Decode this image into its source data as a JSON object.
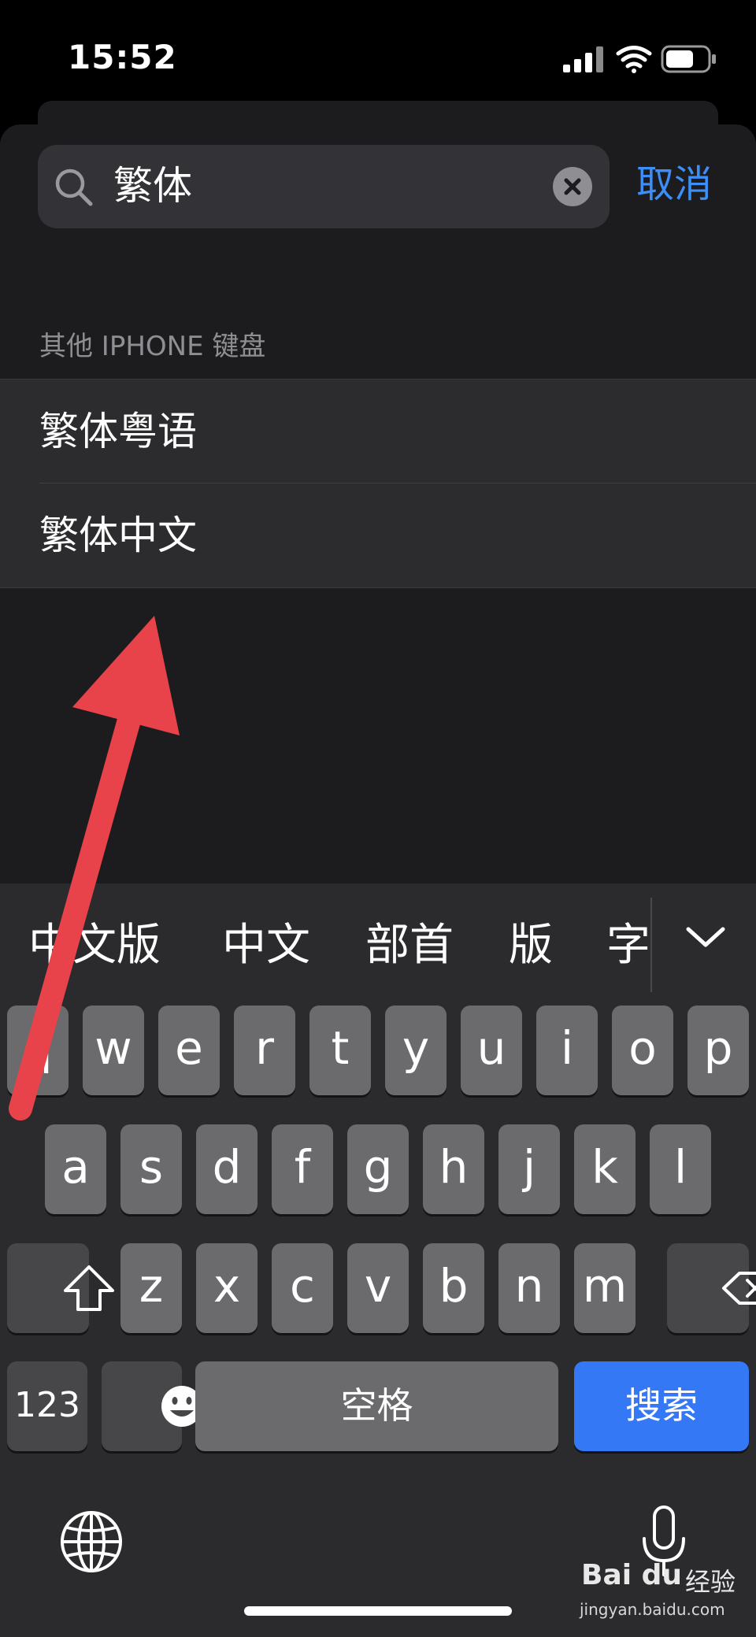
{
  "status_bar": {
    "time": "15:52"
  },
  "search": {
    "query": "繁体",
    "cancel_label": "取消"
  },
  "section": {
    "header": "其他 IPHONE 键盘"
  },
  "results": [
    {
      "label": "繁体粤语"
    },
    {
      "label": "繁体中文"
    }
  ],
  "keyboard": {
    "candidates": [
      "中文版",
      "中文",
      "部首",
      "版",
      "字"
    ],
    "row1": [
      "q",
      "w",
      "e",
      "r",
      "t",
      "y",
      "u",
      "i",
      "o",
      "p"
    ],
    "row2": [
      "a",
      "s",
      "d",
      "f",
      "g",
      "h",
      "j",
      "k",
      "l"
    ],
    "row3": [
      "z",
      "x",
      "c",
      "v",
      "b",
      "n",
      "m"
    ],
    "numbers_label": "123",
    "space_label": "空格",
    "search_label": "搜索"
  },
  "watermark": {
    "logo": "Bai du",
    "brand": "经验",
    "url": "jingyan.baidu.com"
  },
  "colors": {
    "accent": "#3b8ff7",
    "search_key": "#3478f6",
    "annotation_arrow": "#e8434b"
  },
  "icons": [
    "signal-icon",
    "wifi-icon",
    "battery-icon",
    "search-icon",
    "clear-icon",
    "chevron-down-icon",
    "shift-icon",
    "backspace-icon",
    "emoji-icon",
    "globe-icon",
    "mic-icon"
  ]
}
